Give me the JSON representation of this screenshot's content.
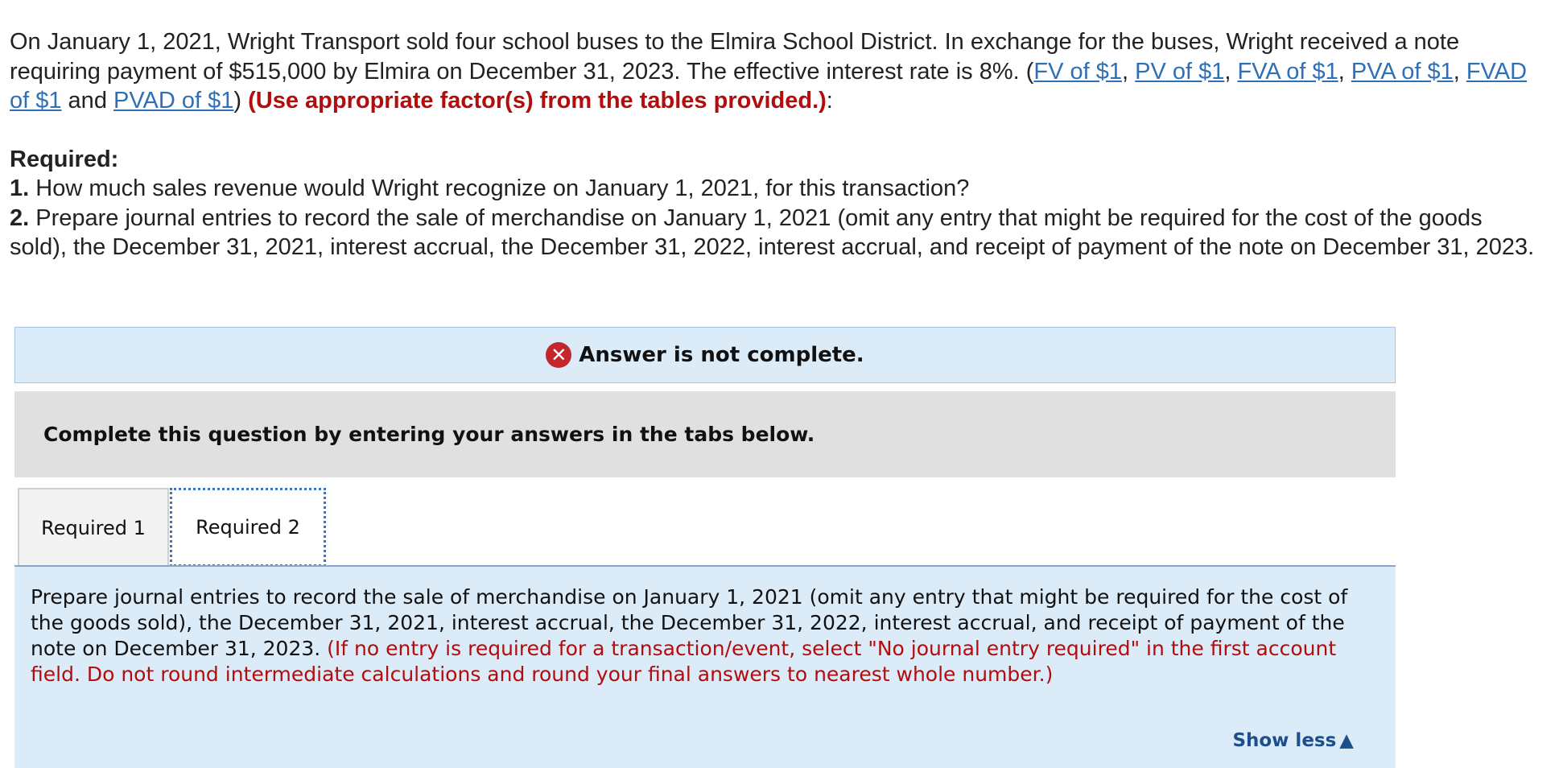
{
  "intro": {
    "text_a": "On January 1, 2021, Wright Transport sold four school buses to the Elmira School District. In exchange for the buses, Wright received a note requiring payment of $515,000 by Elmira on December 31, 2023. The effective interest rate is 8%. (",
    "links": [
      "FV of $1",
      "PV of $1",
      "FVA of $1",
      "PVA of $1",
      "FVAD of $1",
      "PVAD of $1"
    ],
    "sep_comma": ", ",
    "sep_and": " and ",
    "close_paren": ") ",
    "red_note": "(Use appropriate factor(s) from the tables provided.)",
    "colon": ":"
  },
  "required": {
    "heading": "Required:",
    "items": [
      {
        "num": "1.",
        "text": " How much sales revenue would Wright recognize on January 1, 2021, for this transaction?"
      },
      {
        "num": "2.",
        "text": " Prepare journal entries to record the sale of merchandise on January 1, 2021 (omit any entry that might be required for the cost of the goods sold), the December 31, 2021, interest accrual, the December 31, 2022, interest accrual, and receipt of payment of the note on December 31, 2023."
      }
    ]
  },
  "status": {
    "icon": "x-circle-icon",
    "icon_glyph": "✕",
    "message": "Answer is not complete."
  },
  "instruction": "Complete this question by entering your answers in the tabs below.",
  "tabs": [
    {
      "label": "Required 1",
      "active": false
    },
    {
      "label": "Required 2",
      "active": true
    }
  ],
  "panel": {
    "text": "Prepare journal entries to record the sale of merchandise on January 1, 2021 (omit any entry that might be required for the cost of the goods sold), the December 31, 2021, interest accrual, the December 31, 2022, interest accrual, and receipt of payment of the note on December 31, 2023. ",
    "red_text": "(If no entry is required for a transaction/event, select \"No journal entry required\" in the first account field. Do not round intermediate calculations and round your final answers to nearest whole number.)",
    "show_less": "Show less",
    "show_less_icon": "▲"
  },
  "colors": {
    "link": "#2f6fb5",
    "warning_red": "#b30c0c",
    "panel_blue": "#dcebf8",
    "error_icon": "#c1272d",
    "show_less": "#1c4f8b"
  }
}
